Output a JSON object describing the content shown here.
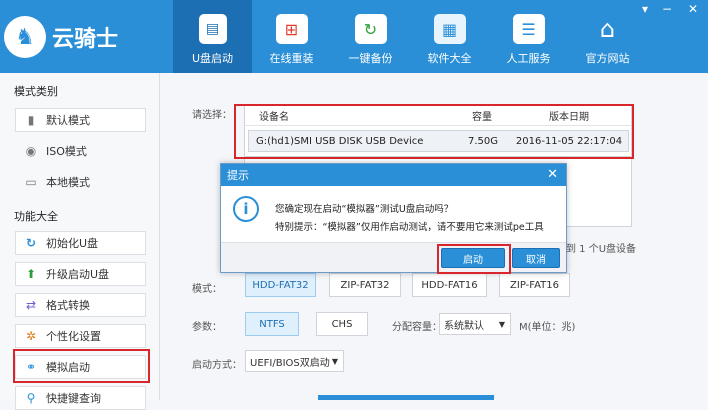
{
  "app": {
    "title": "云骑士"
  },
  "nav": [
    {
      "label": "U盘启动",
      "icon": "usb-drive-icon",
      "active": true
    },
    {
      "label": "在线重装",
      "icon": "windows-monitor-icon"
    },
    {
      "label": "一键备份",
      "icon": "backup-icon"
    },
    {
      "label": "软件大全",
      "icon": "software-bag-icon"
    },
    {
      "label": "人工服务",
      "icon": "chat-service-icon"
    },
    {
      "label": "官方网站",
      "icon": "home-icon"
    }
  ],
  "window": {
    "dropdown": "▾",
    "minimize": "−",
    "close": "✕"
  },
  "sidebar": {
    "mode_title": "模式类别",
    "modes": [
      {
        "label": "默认模式",
        "icon": "usb-stick-icon",
        "glyph": "▮"
      },
      {
        "label": "ISO模式",
        "icon": "disc-icon",
        "glyph": "◉"
      },
      {
        "label": "本地模式",
        "icon": "monitor-icon",
        "glyph": "▭"
      }
    ],
    "func_title": "功能大全",
    "functions": [
      {
        "label": "初始化U盘",
        "icon": "refresh-icon",
        "glyph": "↻",
        "color": "#2a8fd7"
      },
      {
        "label": "升级启动U盘",
        "icon": "arrow-up-icon",
        "glyph": "⬆",
        "color": "#2e9e3a"
      },
      {
        "label": "格式转换",
        "icon": "swap-icon",
        "glyph": "⇄",
        "color": "#6b5fc7"
      },
      {
        "label": "个性化设置",
        "icon": "gear-icon",
        "glyph": "✲",
        "color": "#e07b1a"
      },
      {
        "label": "模拟启动",
        "icon": "link-icon",
        "glyph": "⚭",
        "color": "#2a8fd7"
      },
      {
        "label": "快捷键查询",
        "icon": "search-icon",
        "glyph": "🔍",
        "color": "#2a8fd7"
      }
    ]
  },
  "device": {
    "select_label": "请选择：",
    "headers": [
      "设备名",
      "容量",
      "版本日期"
    ],
    "row": {
      "name": "G:(hd1)SMI USB DISK USB Device",
      "capacity": "7.50G",
      "date": "2016-11-05 22:17:04"
    },
    "count_text": "到 1 个U盘设备"
  },
  "options": {
    "mode_label": "模式：",
    "modes": [
      "HDD-FAT32",
      "ZIP-FAT32",
      "HDD-FAT16",
      "ZIP-FAT16"
    ],
    "param_label": "参数：",
    "params": [
      "NTFS",
      "CHS"
    ],
    "alloc_label": "分配容量：",
    "alloc_value": "系统默认",
    "alloc_unit": "M(单位：兆)",
    "boot_label": "启动方式：",
    "boot_value": "UEFI/BIOS双启动"
  },
  "dialog": {
    "title": "提示",
    "line1": "您确定现在启动“模拟器”测试U盘启动吗？",
    "line2": "特别提示：“模拟器”仅用作启动测试，请不要用它来测试pe工具",
    "confirm": "启动",
    "cancel": "取消"
  },
  "colors": {
    "accent": "#2a8fd7",
    "highlight": "#d9262c"
  }
}
